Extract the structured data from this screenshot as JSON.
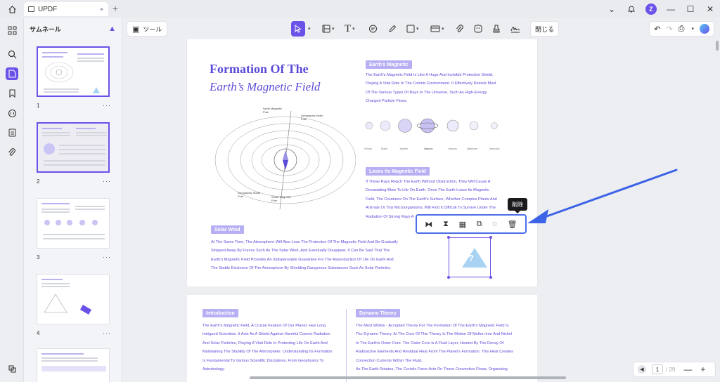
{
  "titlebar": {
    "tab_title": "UPDF",
    "avatar_letter": "Z"
  },
  "panel": {
    "title": "サムネール"
  },
  "thumbnails": [
    {
      "number": "1",
      "more": "···"
    },
    {
      "number": "2",
      "more": "···"
    },
    {
      "number": "3",
      "more": "···"
    },
    {
      "number": "4",
      "more": "···"
    }
  ],
  "toolbar": {
    "tools_label": "ツール",
    "close_label": "閉じる"
  },
  "page1": {
    "title_line1": "Formation Of The",
    "title_line2": "Earth’s Magnetic Field",
    "earths_magnetic": {
      "heading": "Earth's Magnetic",
      "lines": [
        "The Earth's Magnetic Field Is Like A Huge And Invisible Protective Shield,",
        "Playing A Vital Role In The Cosmic Environment. It Effectively Resists Most",
        "Of The Various Types Of Rays In The Universe, Such As High-Energy",
        "Charged Particle Flows."
      ]
    },
    "planets": [
      "Venus",
      "Mars",
      "Jupiter",
      "Saturn",
      "Uranus",
      "Neptune",
      "Mercury"
    ],
    "loses": {
      "heading": "Loses Its Magnetic Field",
      "lines": [
        "If These Rays Reach The Earth Without Obstruction, They Will Cause A",
        "Devastating Blow To Life On Earth. Once The Earth Loses Its Magnetic",
        "Field, The Creatures On The Earth's Surface, Whether Complex Plants And",
        "Animals Or Tiny Microorganisms, Will Find It Difficult To Survive Under The",
        "Radiation Of Strong Rays A"
      ]
    },
    "diagram_labels": {
      "north_magnetic": "North Magnetic Pole",
      "geographic_north": "Geographic North Pole",
      "geographic_south": "Geographic South Pole",
      "south_magnetic": "South Magnetic Pole"
    },
    "solar_wind": {
      "heading": "Solar Wind",
      "lines": [
        "At The Same Time, The Atmosphere Will Also Lose The Protection Of The Magnetic Field And Be Gradually",
        "Stripped Away By Forces Such As The Solar Wind, And Eventually Disappear. It Can Be Said That The",
        "Earth's Magnetic Field Provides An Indispensable Guarantee For The Reproduction Of Life On Earth And",
        "The Stable Existence Of The Atmosphere By Shielding Dangerous Substances Such As Solar Particles."
      ]
    }
  },
  "page2": {
    "introduction": {
      "heading": "Introduction",
      "lines": [
        "The Earth's Magnetic Field, A Crucial Feature Of Our Planet, Has Long",
        "Intrigued Scientists. It Acts As A Shield Against Harmful Cosmic Radiation",
        "And Solar Particles, Playing A Vital Role In Protecting Life On Earth And",
        "Maintaining The Stability Of The Atmosphere. Understanding Its Formation",
        "Is Fundamental To Various Scientific Disciplines, From Geophysics To",
        "Astrobiology."
      ]
    },
    "dynamo": {
      "heading": "Dynamo Theory",
      "lines": [
        "The Most Widely - Accepted Theory For The Formation Of The Earth's Magnetic Field Is",
        "The Dynamo Theory. At The Core Of This Theory Is The Motion Of Molten Iron And Nickel",
        "In The Earth's Outer Core. The Outer Core Is A Fluid Layer, Heated By The Decay Of",
        "Radioactive Elements And Residual Heat From The Planet's Formation. This Heat Creates",
        "Convection Currents Within The Fluid.",
        "As The Earth Rotates, The Coriolis Force Acts On These Convective Flows, Organizing"
      ]
    }
  },
  "tooltip": "削除",
  "zoom": {
    "current_page": "1",
    "total_pages": "/ 29"
  },
  "colors": {
    "accent": "#6a52e8",
    "text_blue": "#5a4cd8",
    "pill": "#b7aff4",
    "arrow": "#3d63e6"
  }
}
